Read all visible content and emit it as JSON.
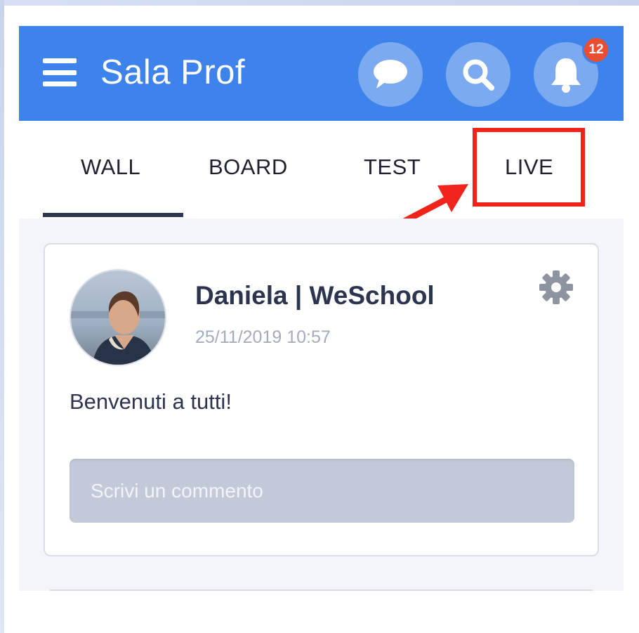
{
  "appbar": {
    "title": "Sala Prof",
    "notification_count": "12",
    "icons": [
      "menu-icon",
      "chat-icon",
      "search-icon",
      "bell-icon"
    ],
    "color": "#3e82eb"
  },
  "tabs": [
    {
      "label": "WALL",
      "active": true
    },
    {
      "label": "BOARD",
      "active": false
    },
    {
      "label": "TEST",
      "active": false
    },
    {
      "label": "LIVE",
      "active": false,
      "highlighted": true
    }
  ],
  "annotation": {
    "highlight_color": "#f0241b",
    "target": "LIVE"
  },
  "post": {
    "author": "Daniela | WeSchool",
    "date": "25/11/2019 10:57",
    "text": "Benvenuti a tutti!",
    "comment_placeholder": "Scrivi un commento",
    "icons": [
      "gear-icon"
    ]
  }
}
